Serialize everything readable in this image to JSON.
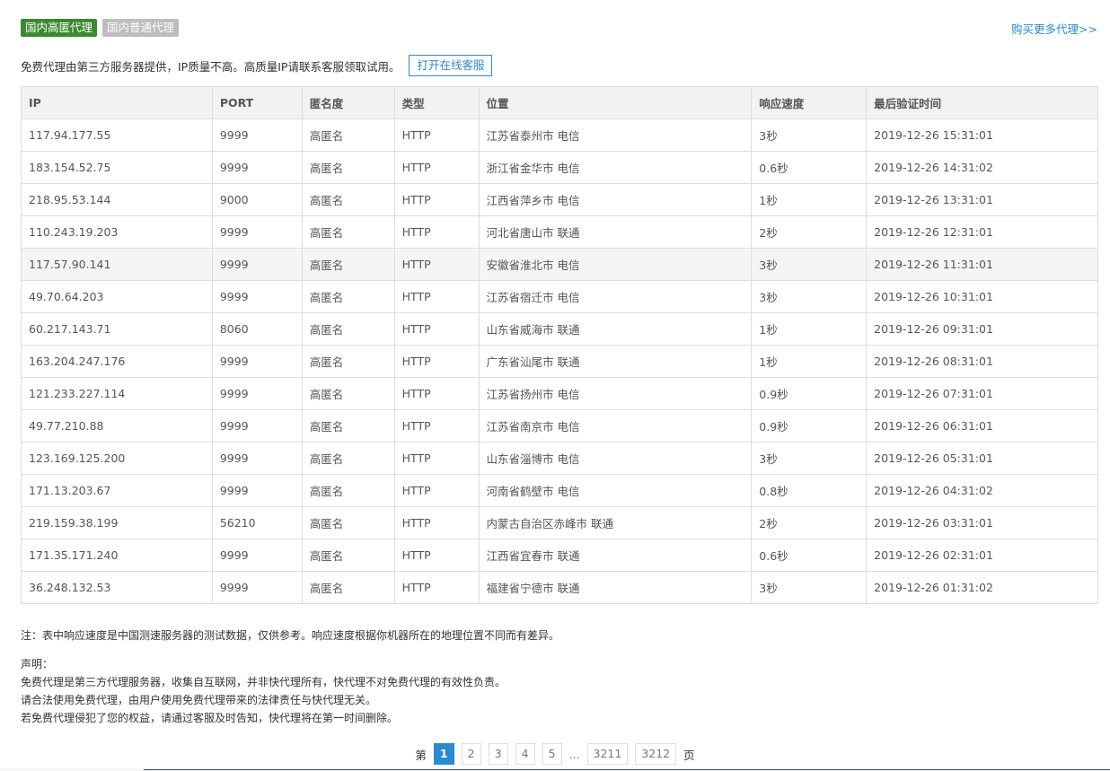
{
  "tabs": [
    {
      "label": "国内高匿代理",
      "active": true
    },
    {
      "label": "国内普通代理",
      "active": false
    }
  ],
  "buy_more": "购买更多代理>>",
  "notice": "免费代理由第三方服务器提供，IP质量不高。高质量IP请联系客服领取试用。",
  "chat_button": "打开在线客服",
  "table": {
    "headers": [
      "IP",
      "PORT",
      "匿名度",
      "类型",
      "位置",
      "响应速度",
      "最后验证时间"
    ],
    "rows": [
      [
        "117.94.177.55",
        "9999",
        "高匿名",
        "HTTP",
        "江苏省泰州市 电信",
        "3秒",
        "2019-12-26 15:31:01"
      ],
      [
        "183.154.52.75",
        "9999",
        "高匿名",
        "HTTP",
        "浙江省金华市 电信",
        "0.6秒",
        "2019-12-26 14:31:02"
      ],
      [
        "218.95.53.144",
        "9000",
        "高匿名",
        "HTTP",
        "江西省萍乡市 电信",
        "1秒",
        "2019-12-26 13:31:01"
      ],
      [
        "110.243.19.203",
        "9999",
        "高匿名",
        "HTTP",
        "河北省唐山市 联通",
        "2秒",
        "2019-12-26 12:31:01"
      ],
      [
        "117.57.90.141",
        "9999",
        "高匿名",
        "HTTP",
        "安徽省淮北市 电信",
        "3秒",
        "2019-12-26 11:31:01"
      ],
      [
        "49.70.64.203",
        "9999",
        "高匿名",
        "HTTP",
        "江苏省宿迁市 电信",
        "3秒",
        "2019-12-26 10:31:01"
      ],
      [
        "60.217.143.71",
        "8060",
        "高匿名",
        "HTTP",
        "山东省威海市 联通",
        "1秒",
        "2019-12-26 09:31:01"
      ],
      [
        "163.204.247.176",
        "9999",
        "高匿名",
        "HTTP",
        "广东省汕尾市 联通",
        "1秒",
        "2019-12-26 08:31:01"
      ],
      [
        "121.233.227.114",
        "9999",
        "高匿名",
        "HTTP",
        "江苏省扬州市 电信",
        "0.9秒",
        "2019-12-26 07:31:01"
      ],
      [
        "49.77.210.88",
        "9999",
        "高匿名",
        "HTTP",
        "江苏省南京市 电信",
        "0.9秒",
        "2019-12-26 06:31:01"
      ],
      [
        "123.169.125.200",
        "9999",
        "高匿名",
        "HTTP",
        "山东省淄博市 电信",
        "3秒",
        "2019-12-26 05:31:01"
      ],
      [
        "171.13.203.67",
        "9999",
        "高匿名",
        "HTTP",
        "河南省鹤壁市 电信",
        "0.8秒",
        "2019-12-26 04:31:02"
      ],
      [
        "219.159.38.199",
        "56210",
        "高匿名",
        "HTTP",
        "内蒙古自治区赤峰市 联通",
        "2秒",
        "2019-12-26 03:31:01"
      ],
      [
        "171.35.171.240",
        "9999",
        "高匿名",
        "HTTP",
        "江西省宜春市 联通",
        "0.6秒",
        "2019-12-26 02:31:01"
      ],
      [
        "36.248.132.53",
        "9999",
        "高匿名",
        "HTTP",
        "福建省宁德市 联通",
        "3秒",
        "2019-12-26 01:31:02"
      ]
    ]
  },
  "speed_note": "注：表中响应速度是中国测速服务器的测试数据，仅供参考。响应速度根据你机器所在的地理位置不同而有差异。",
  "declaration": {
    "title": "声明：",
    "lines": [
      "免费代理是第三方代理服务器，收集自互联网，并非快代理所有，快代理不对免费代理的有效性负责。",
      "请合法使用免费代理，由用户使用免费代理带来的法律责任与快代理无关。",
      "若免费代理侵犯了您的权益，请通过客服及时告知，快代理将在第一时间删除。"
    ]
  },
  "pagination": {
    "prefix": "第",
    "pages": [
      "1",
      "2",
      "3",
      "4",
      "5"
    ],
    "current": "1",
    "ellipsis": "...",
    "tail_pages": [
      "3211",
      "3212"
    ],
    "suffix": "页"
  },
  "colors": {
    "active_tab": "#3b8a2f",
    "inactive_tab": "#bdbdbd",
    "link_blue": "#2a8ad4",
    "header_bg": "#f2f2f2",
    "border": "#dddddd"
  }
}
